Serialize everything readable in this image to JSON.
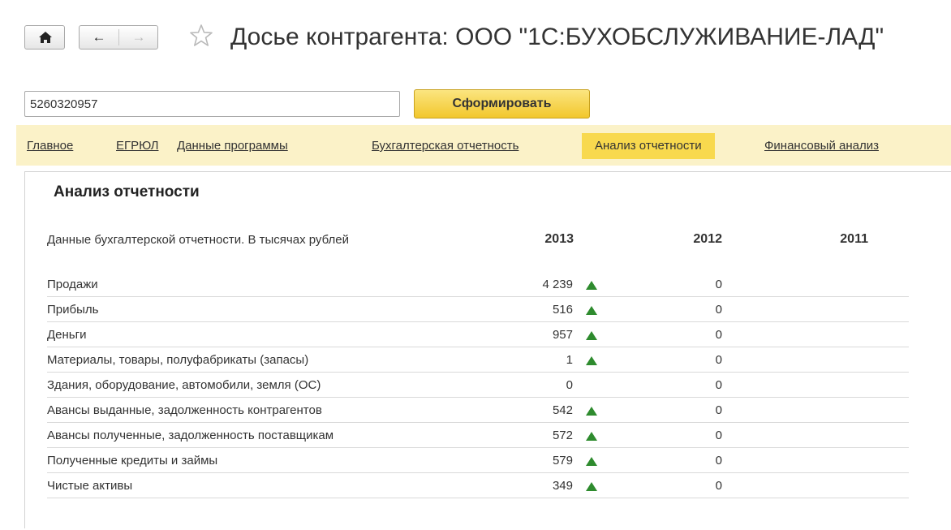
{
  "window": {
    "title": "Досье контрагента: ООО \"1С:БУХОБСЛУЖИВАНИЕ-ЛАД\""
  },
  "toolbar": {
    "home_icon": "home-icon",
    "back_icon": "arrow-left-icon",
    "forward_icon": "arrow-right-icon",
    "favorite_icon": "star-icon"
  },
  "search": {
    "value": "5260320957",
    "button_label": "Сформировать"
  },
  "tabs": [
    {
      "label": "Главное",
      "active": false
    },
    {
      "label": "ЕГРЮЛ",
      "active": false
    },
    {
      "label": "Данные программы",
      "active": false
    },
    {
      "label": "Бухгалтерская отчетность",
      "active": false
    },
    {
      "label": "Анализ отчетности",
      "active": true
    },
    {
      "label": "Финансовый анализ",
      "active": false
    }
  ],
  "report": {
    "title": "Анализ отчетности",
    "caption": "Данные бухгалтерской отчетности. В тысячах рублей",
    "years": [
      "2013",
      "2012",
      "2011"
    ],
    "rows": [
      {
        "label": "Продажи",
        "v2013": "4 239",
        "trend": "up",
        "v2012": "0",
        "v2011": ""
      },
      {
        "label": "Прибыль",
        "v2013": "516",
        "trend": "up",
        "v2012": "0",
        "v2011": ""
      },
      {
        "label": "Деньги",
        "v2013": "957",
        "trend": "up",
        "v2012": "0",
        "v2011": ""
      },
      {
        "label": "Материалы, товары, полуфабрикаты (запасы)",
        "v2013": "1",
        "trend": "up",
        "v2012": "0",
        "v2011": ""
      },
      {
        "label": "Здания, оборудование, автомобили, земля (ОС)",
        "v2013": "0",
        "trend": "none",
        "v2012": "0",
        "v2011": ""
      },
      {
        "label": "Авансы выданные, задолженность контрагентов",
        "v2013": "542",
        "trend": "up",
        "v2012": "0",
        "v2011": ""
      },
      {
        "label": "Авансы полученные, задолженность поставщикам",
        "v2013": "572",
        "trend": "up",
        "v2012": "0",
        "v2011": ""
      },
      {
        "label": "Полученные кредиты и займы",
        "v2013": "579",
        "trend": "up",
        "v2012": "0",
        "v2011": ""
      },
      {
        "label": "Чистые активы",
        "v2013": "349",
        "trend": "up",
        "v2012": "0",
        "v2011": ""
      }
    ],
    "trend_color": "#2e8b2e"
  },
  "colors": {
    "accent": "#f8d94e",
    "tabs_background": "#fbf2c8",
    "button_gradient_top": "#fbe580",
    "button_gradient_bottom": "#f2c72c"
  }
}
